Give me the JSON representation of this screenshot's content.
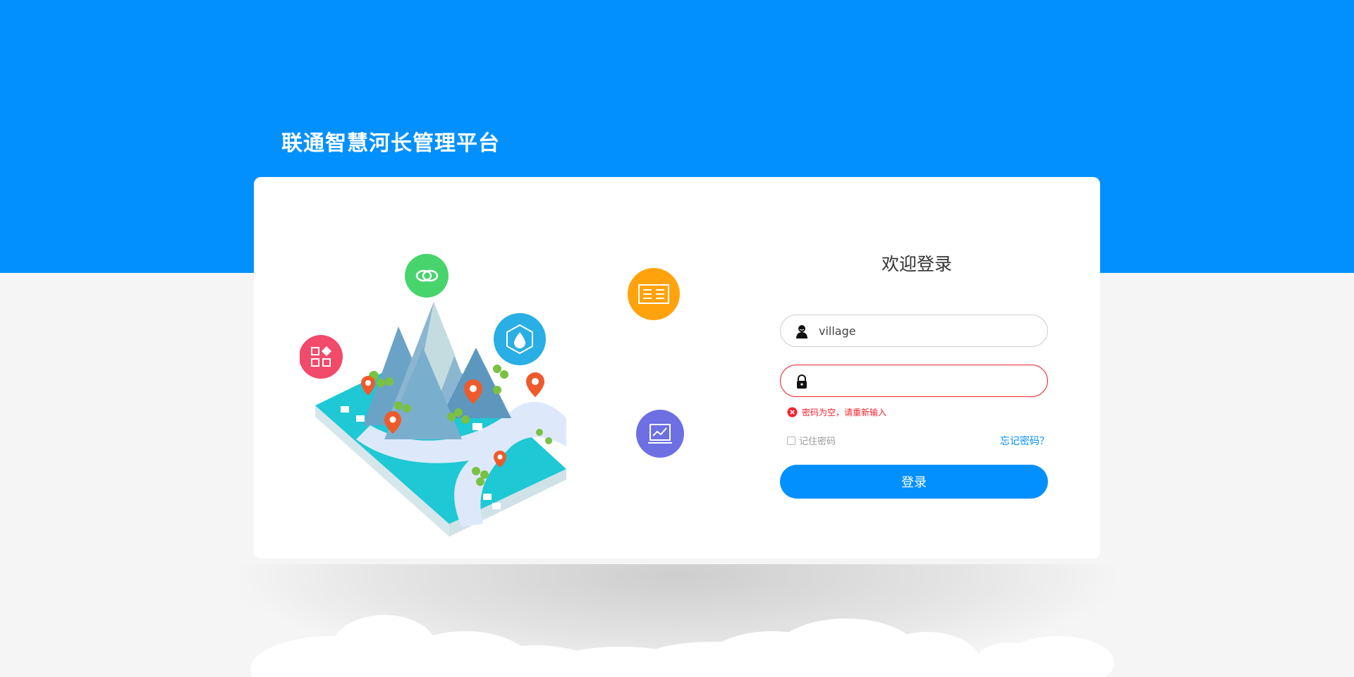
{
  "header": {
    "app_title": "联通智慧河长管理平台"
  },
  "login": {
    "welcome": "欢迎登录",
    "username": {
      "value": "village",
      "icon": "user-icon"
    },
    "password": {
      "value": "",
      "icon": "lock-icon"
    },
    "error_message": "密码为空，请重新输入",
    "remember_label": "记住密码",
    "remember_checked": false,
    "forgot_label": "忘记密码？",
    "submit_label": "登录"
  },
  "illustration": {
    "name": "isometric-river-mountain-illustration",
    "badge_icons": [
      "apps-icon",
      "link-icon",
      "water-drop-icon",
      "report-board-icon",
      "chart-screen-icon"
    ]
  },
  "colors": {
    "primary": "#0290fe",
    "error": "#f5222d",
    "badge_red": "#f24a6b",
    "badge_green": "#48d46c",
    "badge_blue": "#29aee5",
    "badge_orange": "#ffa20c",
    "badge_purple": "#6d6fe3",
    "pin": "#ef5a2c",
    "land": "#1ec8d4"
  }
}
